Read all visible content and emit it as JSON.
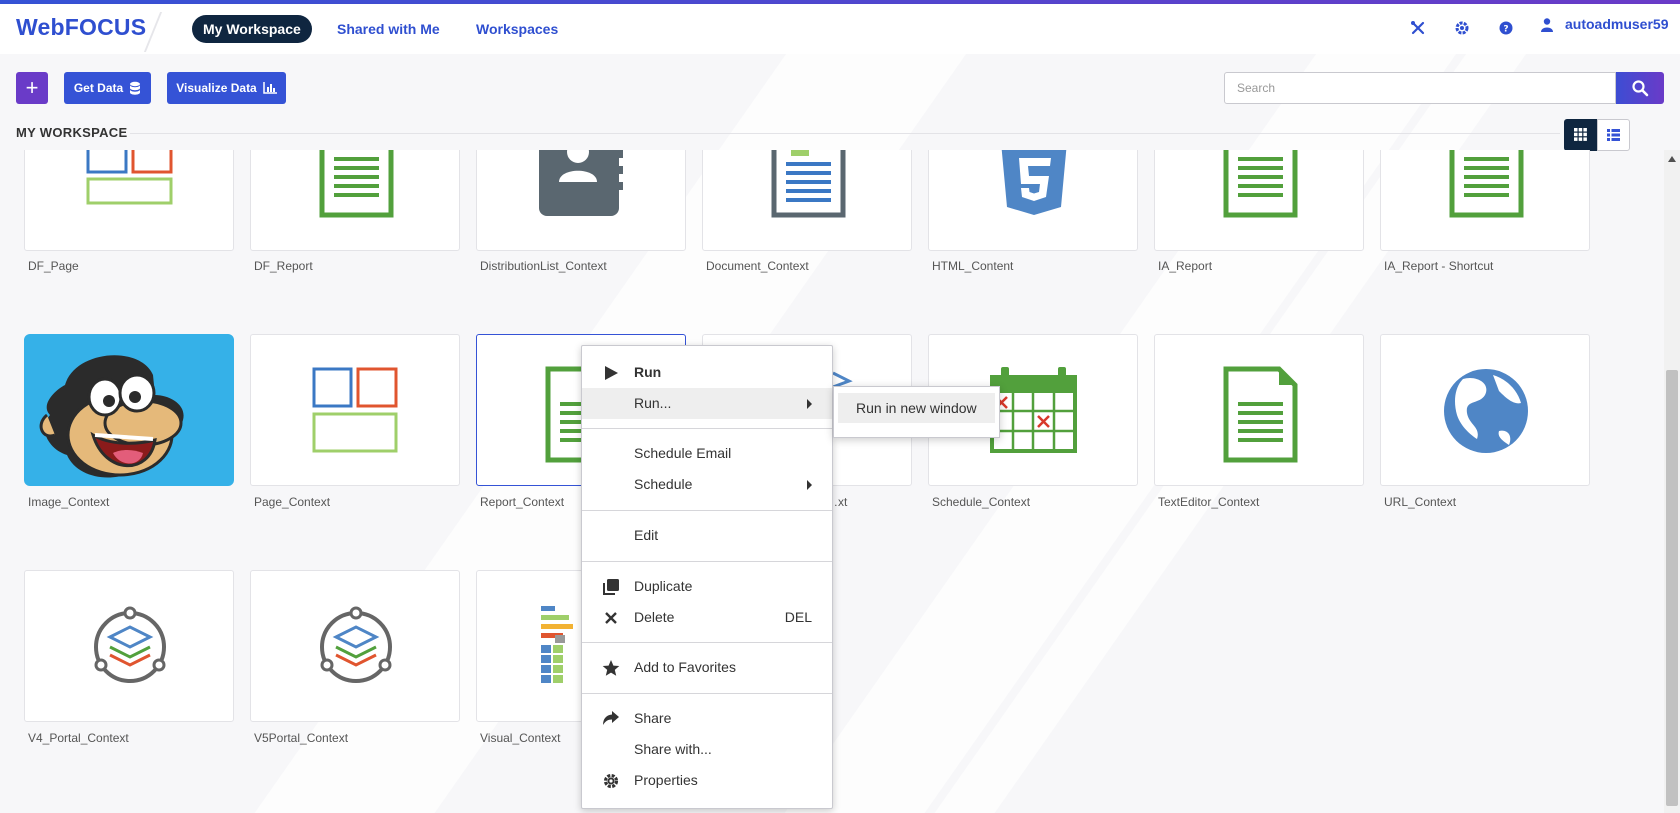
{
  "app": {
    "logo": "WebFOCUS"
  },
  "nav": {
    "tabs": [
      {
        "label": "My Workspace",
        "active": true
      },
      {
        "label": "Shared with Me",
        "active": false
      },
      {
        "label": "Workspaces",
        "active": false
      }
    ],
    "icons": [
      "tools-icon",
      "gear-icon",
      "help-icon"
    ],
    "user": "autoadmuser59"
  },
  "toolbar": {
    "add_label": "+",
    "get_data_label": "Get Data",
    "visualize_label": "Visualize Data",
    "search_placeholder": "Search"
  },
  "section": {
    "title": "MY WORKSPACE",
    "view_mode": "grid"
  },
  "items": [
    {
      "label": "DF_Page",
      "icon": "page-layout-icon"
    },
    {
      "label": "DF_Report",
      "icon": "report-doc-icon"
    },
    {
      "label": "DistributionList_Context",
      "icon": "contact-book-icon"
    },
    {
      "label": "Document_Context",
      "icon": "document-icon"
    },
    {
      "label": "HTML_Content",
      "icon": "html5-icon"
    },
    {
      "label": "IA_Report",
      "icon": "report-doc-icon"
    },
    {
      "label": "IA_Report - Shortcut",
      "icon": "report-doc-icon"
    },
    {
      "label": "Image_Context",
      "icon": "monkey-image-icon"
    },
    {
      "label": "Page_Context",
      "icon": "page-layout-icon"
    },
    {
      "label": "Report_Context",
      "icon": "report-doc-icon",
      "selected": true
    },
    {
      "label": "…xt",
      "icon": "link-icon"
    },
    {
      "label": "Schedule_Context",
      "icon": "calendar-icon"
    },
    {
      "label": "TextEditor_Context",
      "icon": "text-doc-icon"
    },
    {
      "label": "URL_Context",
      "icon": "globe-icon"
    },
    {
      "label": "V4_Portal_Context",
      "icon": "portal-icon"
    },
    {
      "label": "V5Portal_Context",
      "icon": "portal-icon"
    },
    {
      "label": "Visual_Context",
      "icon": "visual-chart-icon"
    }
  ],
  "context_menu": {
    "items": [
      {
        "label": "Run",
        "icon": "play-icon",
        "bold": true
      },
      {
        "label": "Run...",
        "submenu": true,
        "highlighted": true
      },
      {
        "label": "Schedule Email"
      },
      {
        "label": "Schedule",
        "submenu": true
      },
      {
        "label": "Edit"
      },
      {
        "label": "Duplicate",
        "icon": "duplicate-icon"
      },
      {
        "label": "Delete",
        "icon": "close-icon",
        "shortcut": "DEL"
      },
      {
        "label": "Add to Favorites",
        "icon": "star-icon"
      },
      {
        "label": "Share",
        "icon": "share-icon"
      },
      {
        "label": "Share with..."
      },
      {
        "label": "Properties",
        "icon": "gear-icon"
      }
    ],
    "submenu": {
      "label": "Run in new window"
    }
  },
  "colors": {
    "brand": "#2f4fd0",
    "accent_purple": "#6a3bc8",
    "dark_nav": "#0f2640",
    "green": "#52a03c",
    "blue": "#4f86c6"
  }
}
